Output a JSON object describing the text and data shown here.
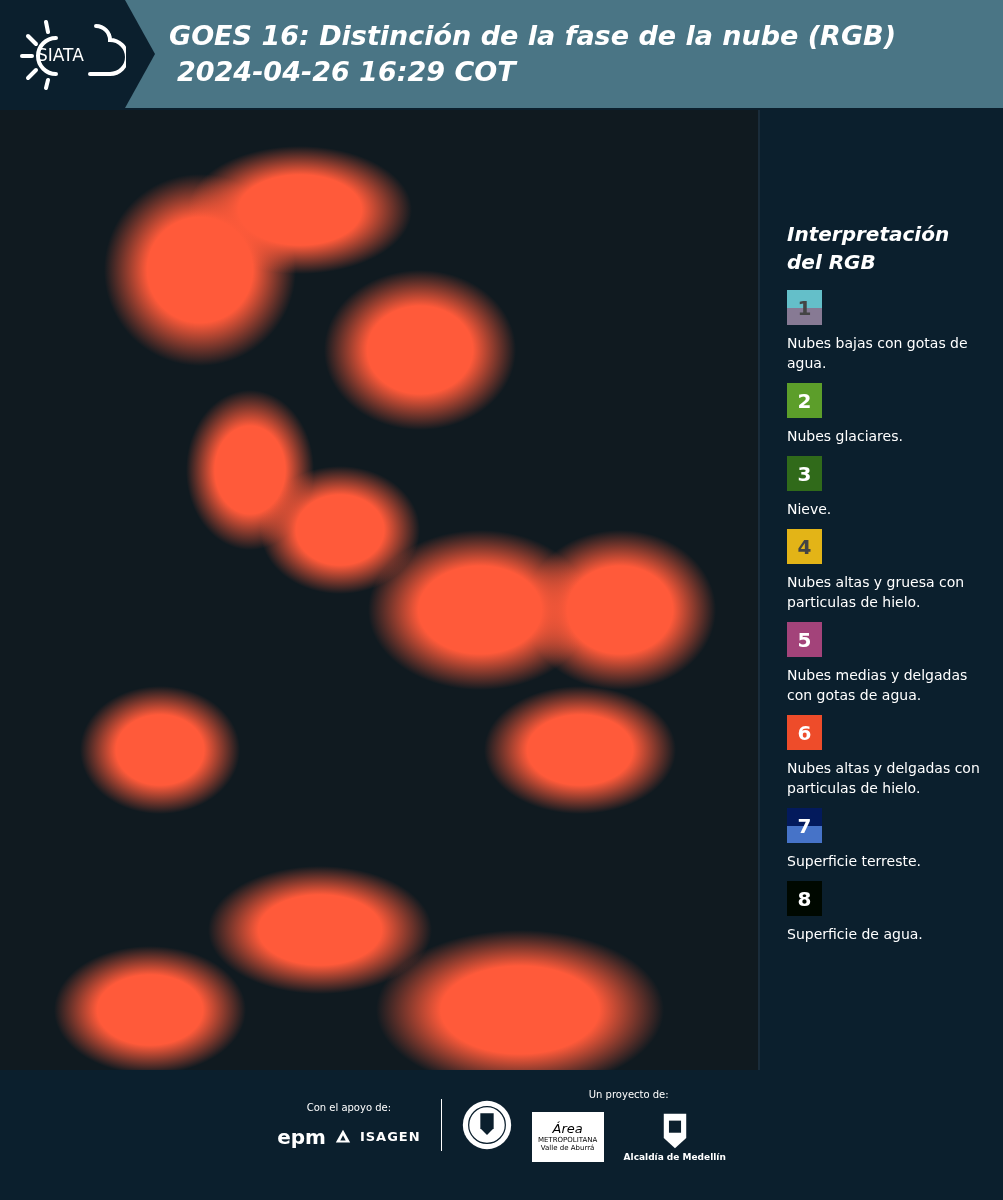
{
  "header": {
    "logo_text": "SIATA",
    "title_line_1": "GOES 16: Distinción de la fase de la nube (RGB)",
    "title_line_2": "2024-04-26 16:29 COT"
  },
  "legend": {
    "title_line_1": "Interpretación",
    "title_line_2": "del RGB",
    "items": [
      {
        "number": "1",
        "bands": [
          {
            "color": "#64bfc9"
          },
          {
            "color": "#877a94"
          }
        ],
        "number_dark": true,
        "label": "Nubes bajas con gotas de agua."
      },
      {
        "number": "2",
        "bands": [
          {
            "color": "#5c9e2a"
          }
        ],
        "number_dark": false,
        "label": "Nubes glaciares."
      },
      {
        "number": "3",
        "bands": [
          {
            "color": "#306a1a"
          }
        ],
        "number_dark": false,
        "label": "Nieve."
      },
      {
        "number": "4",
        "bands": [
          {
            "color": "#e3b417"
          }
        ],
        "number_dark": true,
        "label": "Nubes altas y gruesa con particulas de hielo."
      },
      {
        "number": "5",
        "bands": [
          {
            "color": "#a3437a"
          }
        ],
        "number_dark": false,
        "label": "Nubes medias y delgadas con gotas de agua."
      },
      {
        "number": "6",
        "bands": [
          {
            "color": "#ee4c2a"
          }
        ],
        "number_dark": false,
        "label": "Nubes altas y delgadas con particulas de hielo."
      },
      {
        "number": "7",
        "bands": [
          {
            "color": "#031a5c"
          },
          {
            "color": "#4673c8"
          }
        ],
        "number_dark": false,
        "label": "Superficie terreste."
      },
      {
        "number": "8",
        "bands": [
          {
            "color": "#000800"
          }
        ],
        "number_dark": false,
        "label": "Superficie de agua."
      }
    ]
  },
  "footer": {
    "support_label": "Con el apoyo de:",
    "epm": "epm",
    "isagen": "ISAGEN",
    "project_label": "Un proyecto de:",
    "area_title": "Área",
    "area_subtitle": "METROPOLITANA",
    "area_region": "Valle de Aburrá",
    "alcaldia": "Alcaldía de Medellín"
  }
}
